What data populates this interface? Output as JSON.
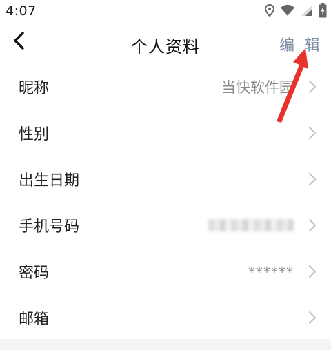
{
  "status_bar": {
    "time": "4:07",
    "icons": [
      "location-icon",
      "wifi-icon",
      "signal-icon",
      "battery-icon"
    ]
  },
  "header": {
    "back_icon": "chevron-left-icon",
    "title": "个人资料",
    "edit_label": "编 辑"
  },
  "rows": [
    {
      "label": "昵称",
      "value": "当快软件园"
    },
    {
      "label": "性别",
      "value": ""
    },
    {
      "label": "出生日期",
      "value": ""
    },
    {
      "label": "手机号码",
      "value": "",
      "value_blurred": true
    },
    {
      "label": "密码",
      "value": "******"
    },
    {
      "label": "邮箱",
      "value": ""
    }
  ],
  "colors": {
    "accent_edit": "#7d8fa3",
    "annotation_arrow": "#e8322b",
    "value_gray": "#8a8a8a",
    "chevron_gray": "#c4c4c4"
  }
}
